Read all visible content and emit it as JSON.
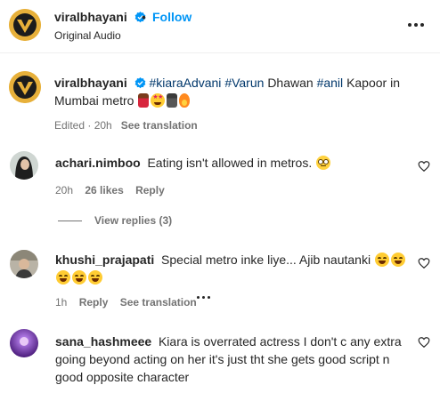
{
  "post": {
    "username": "viralbhayani",
    "dot": "•",
    "follow_label": "Follow",
    "audio": "Original Audio"
  },
  "caption": {
    "username": "viralbhayani",
    "tags": [
      "#kiaraAdvani",
      "#Varun",
      "#anil"
    ],
    "text_1": "Dhawan",
    "text_2": "Kapoor in Mumbai metro",
    "emojis": [
      "dancer-emoji",
      "star-struck-emoji",
      "walking-emoji",
      "fire-emoji"
    ],
    "edited": "Edited · 20h",
    "see_translation": "See translation"
  },
  "comments": [
    {
      "username": "achari.nimboo",
      "text": "Eating isn't allowed in metros.",
      "emoji": "face-with-rolling-eyes-emoji",
      "time": "20h",
      "likes": "26 likes",
      "reply": "Reply",
      "view_replies": "View replies (3)"
    },
    {
      "username": "khushi_prajapati",
      "text": "Special metro inke liye... Ajib nautanki",
      "emoji": "tears-of-joy-emoji",
      "time": "1h",
      "reply": "Reply",
      "see_translation": "See translation"
    },
    {
      "username": "sana_hashmeee",
      "line_1": "Kiara is overrated actress I don't c any extra",
      "line_2": "going beyond acting on her it's just tht she gets good script n",
      "line_3": "good opposite character"
    }
  ],
  "colors": {
    "link": "#0095f6",
    "hashtag": "#00376b",
    "muted": "#737373",
    "text": "#262626",
    "logo_gold": "#e7b03a"
  },
  "icons": [
    "verified-badge-icon",
    "more-options-icon",
    "heart-icon",
    "more-dots-icon"
  ]
}
